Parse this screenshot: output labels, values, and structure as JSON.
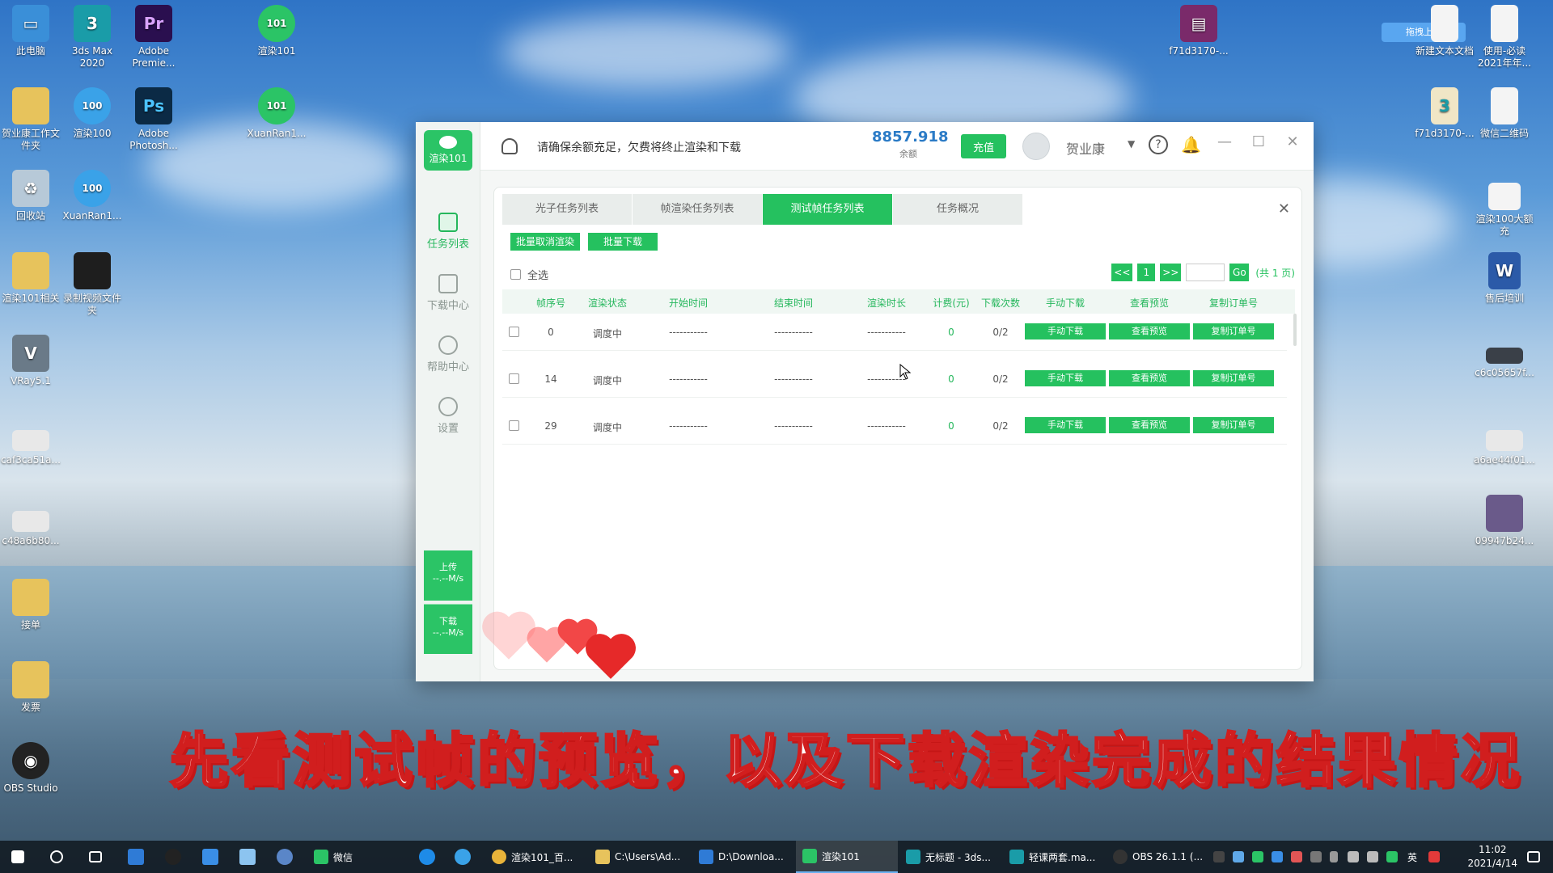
{
  "desktop": {
    "icons": [
      {
        "label": "此电脑"
      },
      {
        "label": "3ds Max\n2020"
      },
      {
        "label": "Adobe\nPremie..."
      },
      {
        "label": "渲染101"
      },
      {
        "label": "贺业康工作文\n件夹"
      },
      {
        "label": "渲染100"
      },
      {
        "label": "Adobe\nPhotosh..."
      },
      {
        "label": "XuanRan1..."
      },
      {
        "label": "回收站"
      },
      {
        "label": "XuanRan1..."
      },
      {
        "label": "渲染101相关"
      },
      {
        "label": "录制视频文件\n夹"
      },
      {
        "label": "VRay5.1"
      },
      {
        "label": "caf3ca51a..."
      },
      {
        "label": "c48a6b80..."
      },
      {
        "label": "接单"
      },
      {
        "label": "发票"
      },
      {
        "label": "OBS Studio"
      },
      {
        "label": "f71d3170-..."
      },
      {
        "label": "新建文本文档"
      },
      {
        "label": "使用-必读\n2021年年..."
      },
      {
        "label": "f71d3170-..."
      },
      {
        "label": "微信二维码"
      },
      {
        "label": "渲染100大额\n充"
      },
      {
        "label": "售后培训"
      },
      {
        "label": "c6c05657f..."
      },
      {
        "label": "a6ae44f01..."
      },
      {
        "label": "09947b24..."
      }
    ],
    "baidu_upload": "拖拽上传"
  },
  "app": {
    "logo_label": "渲染101",
    "nav": [
      {
        "label": "任务列表",
        "active": true
      },
      {
        "label": "下载中心",
        "active": false
      },
      {
        "label": "帮助中心",
        "active": false
      },
      {
        "label": "设置",
        "active": false
      }
    ],
    "upload": {
      "label": "上传",
      "speed": "--.--M/s"
    },
    "download": {
      "label": "下载",
      "speed": "--.--M/s"
    },
    "notice": "请确保余额充足，欠费将终止渲染和下载",
    "balance_value": "8857.918",
    "balance_label": "余额",
    "recharge_label": "充值",
    "user_name": "贺业康",
    "tabs": [
      {
        "label": "光子任务列表",
        "active": false
      },
      {
        "label": "帧渲染任务列表",
        "active": false
      },
      {
        "label": "测试帧任务列表",
        "active": true
      },
      {
        "label": "任务概况",
        "active": false
      }
    ],
    "bulk_cancel": "批量取消渲染",
    "bulk_download": "批量下载",
    "select_all": "全选",
    "pager": {
      "prev": "<<",
      "current": "1",
      "next": ">>",
      "go": "Go",
      "total": "(共 1 页)"
    },
    "columns": [
      "帧序号",
      "渲染状态",
      "开始时间",
      "结束时间",
      "渲染时长",
      "计费(元)",
      "下载次数",
      "手动下载",
      "查看预览",
      "复制订单号"
    ],
    "rows": [
      {
        "frame": "0",
        "status": "调度中",
        "start": "-----------",
        "end": "-----------",
        "duration": "-----------",
        "cost": "0",
        "downloads": "0/2"
      },
      {
        "frame": "14",
        "status": "调度中",
        "start": "-----------",
        "end": "-----------",
        "duration": "-----------",
        "cost": "0",
        "downloads": "0/2"
      },
      {
        "frame": "29",
        "status": "调度中",
        "start": "-----------",
        "end": "-----------",
        "duration": "-----------",
        "cost": "0",
        "downloads": "0/2"
      }
    ],
    "row_actions": {
      "download": "手动下载",
      "preview": "查看预览",
      "copy": "复制订单号"
    }
  },
  "subtitle": "先看测试帧的预览，以及下载渲染完成的结果情况",
  "taskbar": {
    "tasks": [
      {
        "label": "微信"
      },
      {
        "label": "渲染101_百..."
      },
      {
        "label": "C:\\Users\\Ad..."
      },
      {
        "label": "D:\\Downloa..."
      },
      {
        "label": "渲染101",
        "active": true
      },
      {
        "label": "无标题 - 3ds..."
      },
      {
        "label": "轻课两套.ma..."
      },
      {
        "label": "OBS 26.1.1 (..."
      }
    ],
    "ime": "英",
    "time": "11:02",
    "date": "2021/4/14"
  },
  "colors": {
    "accent": "#25c15f",
    "balance": "#2b7bc6",
    "subtitle_stroke": "#d11e1e"
  }
}
